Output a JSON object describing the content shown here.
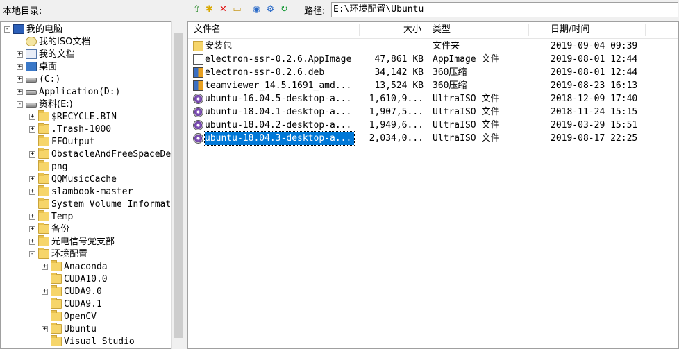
{
  "left_pane": {
    "header_title": "本地目录:",
    "tree": [
      {
        "label": "我的电脑",
        "icon": "computer-icon",
        "expander": "-",
        "indent": 0
      },
      {
        "label": "我的ISO文档",
        "icon": "iso-docs-icon",
        "expander": "",
        "indent": 1
      },
      {
        "label": "我的文档",
        "icon": "documents-icon",
        "expander": "+",
        "indent": 1
      },
      {
        "label": "桌面",
        "icon": "desktop-icon",
        "expander": "+",
        "indent": 1
      },
      {
        "label": "(C:)",
        "icon": "drive-icon",
        "expander": "+",
        "indent": 1
      },
      {
        "label": "Application(D:)",
        "icon": "drive-icon",
        "expander": "+",
        "indent": 1
      },
      {
        "label": "资料(E:)",
        "icon": "drive-icon",
        "expander": "-",
        "indent": 1
      },
      {
        "label": "$RECYCLE.BIN",
        "icon": "folder-icon",
        "expander": "+",
        "indent": 2
      },
      {
        "label": ".Trash-1000",
        "icon": "folder-icon",
        "expander": "+",
        "indent": 2
      },
      {
        "label": "FFOutput",
        "icon": "folder-icon",
        "expander": "",
        "indent": 2
      },
      {
        "label": "ObstacleAndFreeSpaceDet",
        "icon": "folder-icon",
        "expander": "+",
        "indent": 2
      },
      {
        "label": "png",
        "icon": "folder-icon",
        "expander": "",
        "indent": 2
      },
      {
        "label": "QQMusicCache",
        "icon": "folder-icon",
        "expander": "+",
        "indent": 2
      },
      {
        "label": "slambook-master",
        "icon": "folder-icon",
        "expander": "+",
        "indent": 2
      },
      {
        "label": "System Volume Informati",
        "icon": "folder-icon",
        "expander": "",
        "indent": 2
      },
      {
        "label": "Temp",
        "icon": "folder-icon",
        "expander": "+",
        "indent": 2
      },
      {
        "label": "备份",
        "icon": "folder-icon",
        "expander": "+",
        "indent": 2
      },
      {
        "label": "光电信号党支部",
        "icon": "folder-icon",
        "expander": "+",
        "indent": 2
      },
      {
        "label": "环境配置",
        "icon": "folder-icon",
        "expander": "-",
        "indent": 2
      },
      {
        "label": "Anaconda",
        "icon": "folder-icon",
        "expander": "+",
        "indent": 3
      },
      {
        "label": "CUDA10.0",
        "icon": "folder-icon",
        "expander": "",
        "indent": 3
      },
      {
        "label": "CUDA9.0",
        "icon": "folder-icon",
        "expander": "+",
        "indent": 3
      },
      {
        "label": "CUDA9.1",
        "icon": "folder-icon",
        "expander": "",
        "indent": 3
      },
      {
        "label": "OpenCV",
        "icon": "folder-icon",
        "expander": "",
        "indent": 3
      },
      {
        "label": "Ubuntu",
        "icon": "folder-icon",
        "expander": "+",
        "indent": 3
      },
      {
        "label": "Visual Studio",
        "icon": "folder-icon",
        "expander": "",
        "indent": 3
      }
    ]
  },
  "toolbar": {
    "path_label": "路径:",
    "path_value": "E:\\环境配置\\Ubuntu"
  },
  "file_list": {
    "columns": {
      "name": "文件名",
      "size": "大小",
      "type": "类型",
      "date": "日期/时间"
    },
    "rows": [
      {
        "name": "安装包",
        "size": "",
        "type": "文件夹",
        "date": "2019-09-04 09:39",
        "icon": "folder-icon"
      },
      {
        "name": "electron-ssr-0.2.6.AppImage",
        "size": "47,861 KB",
        "type": "AppImage 文件",
        "date": "2019-08-01 12:44",
        "icon": "appimage-file-icon"
      },
      {
        "name": "electron-ssr-0.2.6.deb",
        "size": "34,142 KB",
        "type": "360压缩",
        "date": "2019-08-01 12:44",
        "icon": "archive-file-icon"
      },
      {
        "name": "teamviewer_14.5.1691_amd...",
        "size": "13,524 KB",
        "type": "360压缩",
        "date": "2019-08-23 16:13",
        "icon": "archive-file-icon"
      },
      {
        "name": "ubuntu-16.04.5-desktop-a...",
        "size": "1,610,9...",
        "type": "UltraISO 文件",
        "date": "2018-12-09 17:40",
        "icon": "iso-file-icon"
      },
      {
        "name": "ubuntu-18.04.1-desktop-a...",
        "size": "1,907,5...",
        "type": "UltraISO 文件",
        "date": "2018-11-24 15:15",
        "icon": "iso-file-icon"
      },
      {
        "name": "ubuntu-18.04.2-desktop-a...",
        "size": "1,949,6...",
        "type": "UltraISO 文件",
        "date": "2019-03-29 15:51",
        "icon": "iso-file-icon"
      },
      {
        "name": "ubuntu-18.04.3-desktop-a...",
        "size": "2,034,0...",
        "type": "UltraISO 文件",
        "date": "2019-08-17 22:25",
        "icon": "iso-file-icon",
        "selected": true
      }
    ]
  },
  "colors": {
    "selection": "#0078d7",
    "folder": "#f6d56a"
  }
}
